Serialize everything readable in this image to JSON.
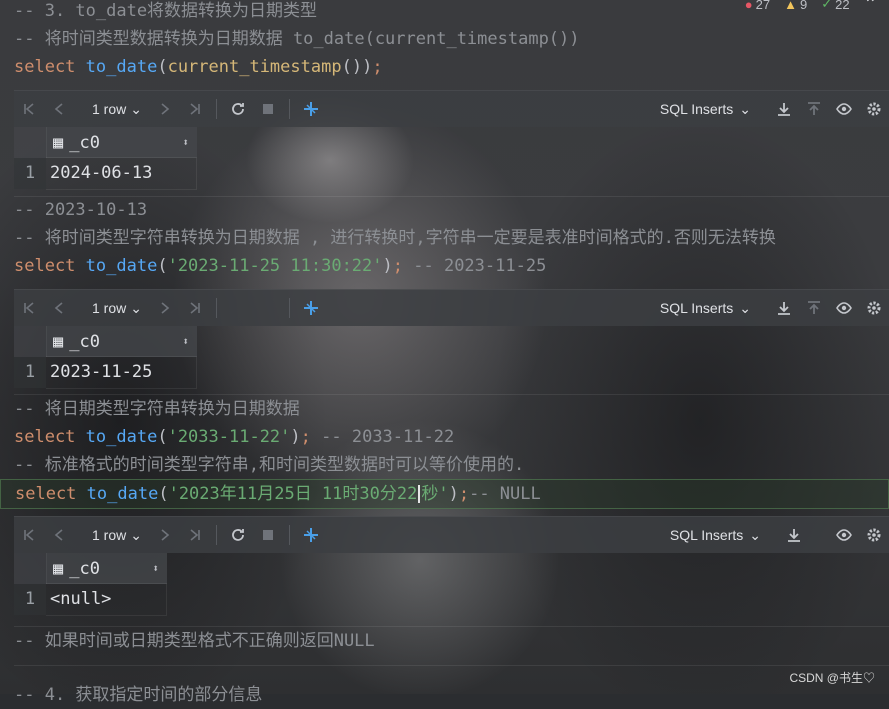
{
  "status": {
    "errors": "27",
    "warnings": "9",
    "checks": "22",
    "error_color": "#e55765",
    "warning_color": "#f2c55c",
    "check_color": "#5fb865"
  },
  "lines": {
    "l1": "-- 3. to_date将数据转换为日期类型",
    "l2": "-- 将时间类型数据转换为日期数据 to_date(current_timestamp())",
    "l3": {
      "kw": "select",
      "fn": "to_date",
      "p1": "(",
      "fn2": "current_timestamp",
      "p2": "()",
      "p3": ")",
      "semi": ";"
    },
    "l4": "-- 2023-10-13",
    "l5": "-- 将时间类型字符串转换为日期数据 , 进行转换时,字符串一定要是表准时间格式的.否则无法转换",
    "l6": {
      "kw": "select",
      "fn": "to_date",
      "p1": "(",
      "str": "'2023-11-25 11:30:22'",
      "p3": ")",
      "semi": ";",
      "comment": " -- 2023-11-25"
    },
    "l7": "-- 将日期类型字符串转换为日期数据",
    "l8": {
      "kw": "select",
      "fn": "to_date",
      "p1": "(",
      "str": "'2033-11-22'",
      "p3": ")",
      "semi": ";",
      "comment": " -- 2033-11-22"
    },
    "l9": "-- 标准格式的时间类型字符串,和时间类型数据时可以等价使用的.",
    "l10": {
      "kw": "select",
      "fn": "to_date",
      "p1": "(",
      "str_a": "'2023年11月25日 11时30分22",
      "str_b": "秒'",
      "p3": ")",
      "semi": ";",
      "comment": "-- NULL"
    },
    "l11": "-- 如果时间或日期类型格式不正确则返回NULL",
    "l12": "-- 4. 获取指定时间的部分信息"
  },
  "toolbars": [
    {
      "rows": "1 row",
      "format": "SQL Inserts"
    },
    {
      "rows": "1 row",
      "format": "SQL Inserts"
    },
    {
      "rows": "1 row",
      "format": "SQL Inserts"
    }
  ],
  "grids": [
    {
      "column": "_c0",
      "row_index": "1",
      "value": "2024-06-13"
    },
    {
      "column": "_c0",
      "row_index": "1",
      "value": "2023-11-25"
    },
    {
      "column": "_c0",
      "row_index": "1",
      "value": "<null>"
    }
  ],
  "watermark": "CSDN @书生♡",
  "icons": [
    "first-page-icon",
    "prev-page-icon",
    "next-page-icon",
    "last-page-icon",
    "refresh-icon",
    "stop-icon",
    "pin-icon",
    "download-icon",
    "upload-icon",
    "eye-icon",
    "gear-icon",
    "chevron-down-icon",
    "table-icon",
    "sort-icon"
  ]
}
